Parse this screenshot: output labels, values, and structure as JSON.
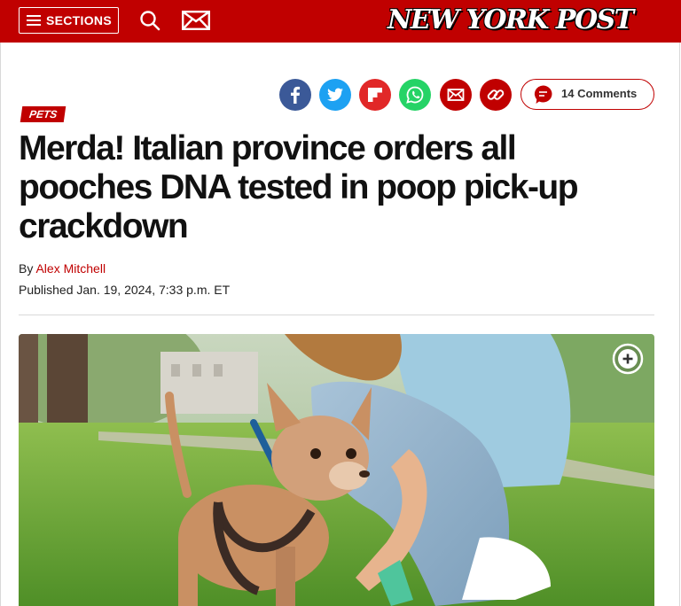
{
  "header": {
    "sections_label": "SECTIONS",
    "logo_text": "NEW YORK POST",
    "brand_color": "#c00000"
  },
  "share": {
    "buttons": [
      "facebook-icon",
      "twitter-icon",
      "flipboard-icon",
      "whatsapp-icon",
      "email-icon",
      "link-icon"
    ],
    "comments_label": "14 Comments"
  },
  "article": {
    "tag": "PETS",
    "headline": "Merda! Italian province orders all pooches DNA tested in poop pick-up crackdown",
    "byline_prefix": "By",
    "author": "Alex Mitchell",
    "published": "Published Jan. 19, 2024, 7:33 p.m. ET"
  },
  "photo": {
    "subject": "photo",
    "expand_icon": "plus-circle-icon"
  }
}
